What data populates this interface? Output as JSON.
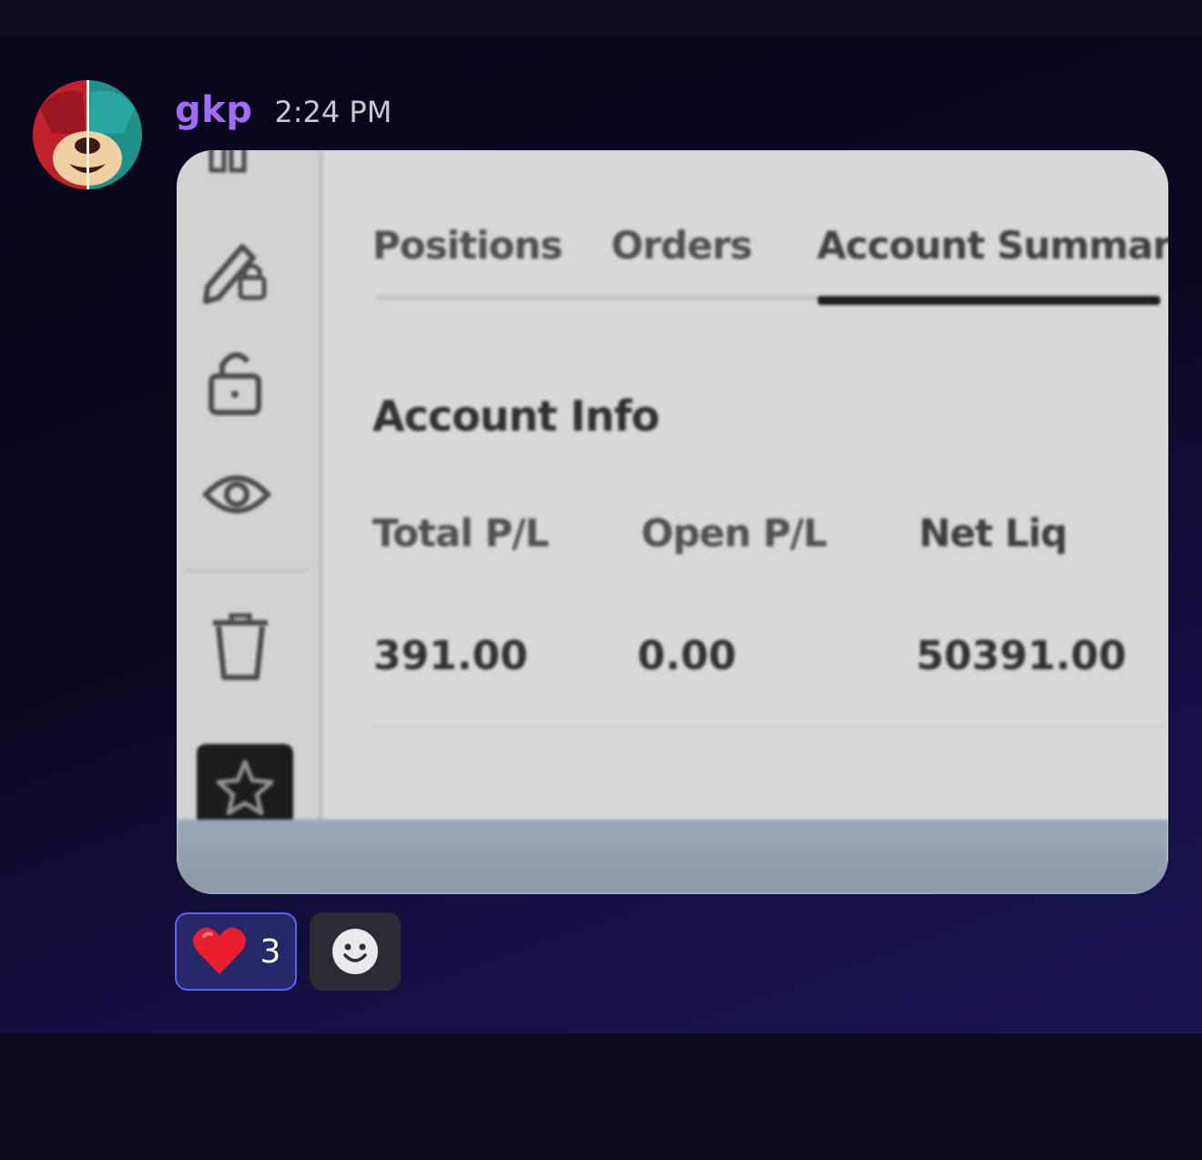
{
  "message": {
    "author": "gkp",
    "timestamp": "2:24 PM",
    "author_color": "#a06cf2"
  },
  "attachment": {
    "sidebar_icons": [
      "pencil-lock-icon",
      "unlock-icon",
      "eye-icon",
      "trash-icon",
      "star-icon"
    ],
    "tabs": [
      {
        "label": "Positions",
        "active": false
      },
      {
        "label": "Orders",
        "active": false
      },
      {
        "label": "Account Summary",
        "active": true
      }
    ],
    "section_title": "Account Info",
    "columns": [
      {
        "label": "Total P/L",
        "value": "391.00"
      },
      {
        "label": "Open P/L",
        "value": "0.00"
      },
      {
        "label": "Net Liq",
        "value": "50391.00"
      }
    ]
  },
  "reactions": [
    {
      "emoji": "heart-icon",
      "count": "3",
      "selected": true
    }
  ],
  "add_reaction_icon": "smiley-icon",
  "colors": {
    "accent": "#5865f2",
    "background": "#0b0a1c"
  }
}
